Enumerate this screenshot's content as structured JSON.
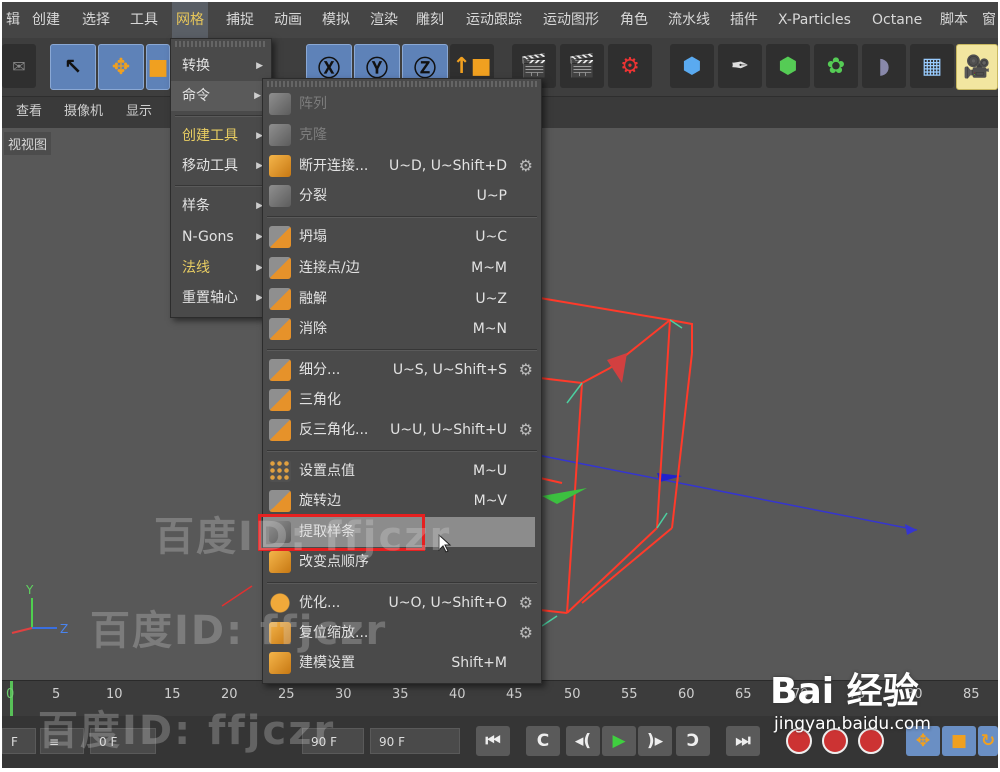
{
  "menubar": [
    "辑",
    "创建",
    "选择",
    "工具",
    "网格",
    "捕捉",
    "动画",
    "模拟",
    "渲染",
    "雕刻",
    "运动跟踪",
    "运动图形",
    "角色",
    "流水线",
    "插件",
    "X-Particles",
    "Octane",
    "脚本",
    "窗"
  ],
  "viewbar": [
    "查看",
    "摄像机",
    "显示"
  ],
  "viewport": {
    "label": "视视图"
  },
  "axis": {
    "y": "Y",
    "z": "Z"
  },
  "mesh_menu": [
    {
      "label": "转换",
      "arrow": true
    },
    {
      "label": "命令",
      "arrow": true,
      "active": true
    },
    {
      "label": "创建工具",
      "arrow": true,
      "highlight": true
    },
    {
      "label": "移动工具",
      "arrow": true
    },
    {
      "label": "样条",
      "arrow": true
    },
    {
      "label": "N-Gons",
      "arrow": true
    },
    {
      "label": "法线",
      "arrow": true,
      "highlight": true
    },
    {
      "label": "重置轴心",
      "arrow": true
    }
  ],
  "command_menu": [
    {
      "label": "阵列",
      "shortcut": "",
      "disabled": true,
      "icon": "grey"
    },
    {
      "label": "克隆",
      "shortcut": "",
      "disabled": true,
      "icon": "grey"
    },
    {
      "label": "断开连接...",
      "shortcut": "U~D, U~Shift+D",
      "gear": true,
      "icon": "orange"
    },
    {
      "label": "分裂",
      "shortcut": "U~P",
      "icon": "grey"
    },
    {
      "label": "坍塌",
      "shortcut": "U~C",
      "icon": "mixed"
    },
    {
      "label": "连接点/边",
      "shortcut": "M~M",
      "icon": "mixed"
    },
    {
      "label": "融解",
      "shortcut": "U~Z",
      "icon": "mixed"
    },
    {
      "label": "消除",
      "shortcut": "M~N",
      "icon": "mixed"
    },
    {
      "label": "细分...",
      "shortcut": "U~S, U~Shift+S",
      "gear": true,
      "icon": "mixed"
    },
    {
      "label": "三角化",
      "shortcut": "",
      "icon": "mixed"
    },
    {
      "label": "反三角化...",
      "shortcut": "U~U, U~Shift+U",
      "gear": true,
      "icon": "mixed"
    },
    {
      "label": "设置点值",
      "shortcut": "M~U",
      "icon": "dots"
    },
    {
      "label": "旋转边",
      "shortcut": "M~V",
      "icon": "mixed"
    },
    {
      "label": "提取样条",
      "shortcut": "",
      "icon": "grey",
      "selected": true
    },
    {
      "label": "改变点顺序",
      "shortcut": "",
      "icon": "orange"
    },
    {
      "label": "优化...",
      "shortcut": "U~O, U~Shift+O",
      "gear": true,
      "icon": "recycle"
    },
    {
      "label": "复位缩放...",
      "shortcut": "",
      "gear": true,
      "icon": "orange"
    },
    {
      "label": "建模设置",
      "shortcut": "Shift+M",
      "icon": "orange"
    }
  ],
  "timeline": [
    "0",
    "5",
    "10",
    "15",
    "20",
    "25",
    "30",
    "35",
    "40",
    "45",
    "50",
    "55",
    "60",
    "65",
    "70",
    "75",
    "80",
    "85"
  ],
  "bottom": {
    "field1": "F",
    "field2": "0 F",
    "field3": "90 F",
    "field4": "90 F"
  },
  "watermark": [
    "百度ID: ffjczr",
    "百度ID: ffjczr",
    "百度ID: ffjczr"
  ],
  "baidu": {
    "logo": "Bai 经验",
    "url": "jingyan.baidu.com"
  }
}
